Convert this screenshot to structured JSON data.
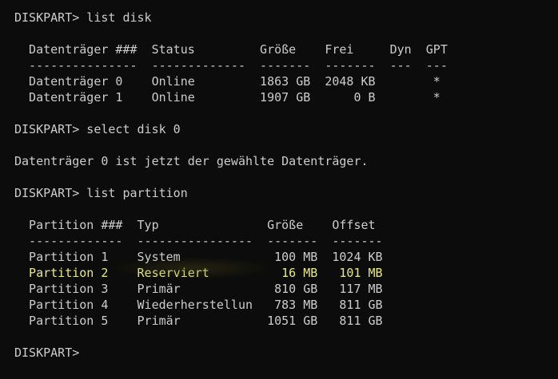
{
  "console": {
    "lines": [
      {
        "text": "DISKPART> list disk"
      },
      {
        "text": ""
      },
      {
        "text": "  Datenträger ###  Status         Größe    Frei     Dyn  GPT"
      },
      {
        "text": "  ---------------  -------------  -------  -------  ---  ---"
      },
      {
        "text": "  Datenträger 0    Online         1863 GB  2048 KB        *"
      },
      {
        "text": "  Datenträger 1    Online         1907 GB      0 B        *"
      },
      {
        "text": ""
      },
      {
        "text": "DISKPART> select disk 0"
      },
      {
        "text": ""
      },
      {
        "text": "Datenträger 0 ist jetzt der gewählte Datenträger."
      },
      {
        "text": ""
      },
      {
        "text": "DISKPART> list partition"
      },
      {
        "text": ""
      },
      {
        "text": "  Partition ###  Typ               Größe    Offset"
      },
      {
        "text": "  -------------  ----------------  -------  -------"
      },
      {
        "text": "  Partition 1    System             100 MB  1024 KB"
      },
      {
        "text": "  Partition 2    Reserviert          16 MB   101 MB"
      },
      {
        "text": "  Partition 3    Primär             810 GB   117 MB"
      },
      {
        "text": "  Partition 4    Wiederherstellun   783 MB   811 GB"
      },
      {
        "text": "  Partition 5    Primär            1051 GB   811 GB"
      },
      {
        "text": ""
      },
      {
        "text": "DISKPART> "
      }
    ]
  },
  "colors": {
    "background": "#0c0c0c",
    "text": "#cccccc",
    "highlight": "#e9e98a"
  }
}
